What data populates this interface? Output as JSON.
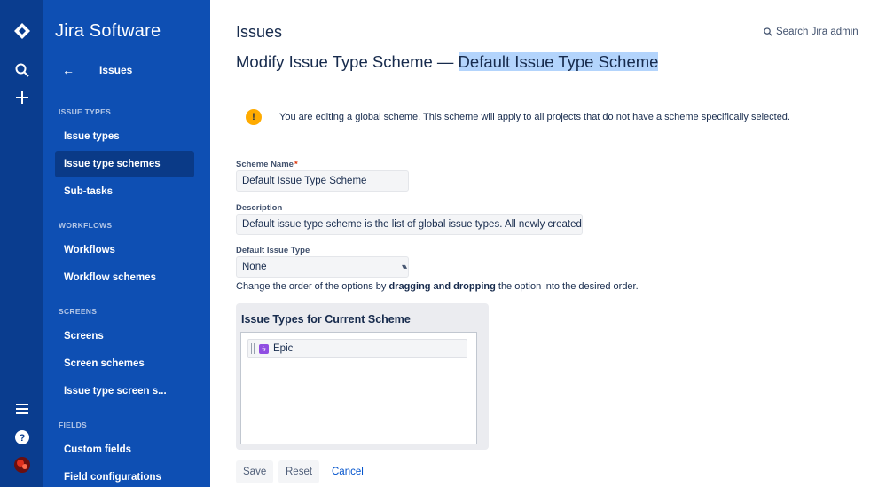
{
  "rail": {
    "icons": [
      "jira-logo-icon",
      "search-icon",
      "create-icon",
      "menu-icon",
      "help-icon",
      "avatar"
    ]
  },
  "sidebar": {
    "brand": "Jira Software",
    "back_label": "Issues",
    "sections": [
      {
        "heading": "ISSUE TYPES",
        "items": [
          {
            "label": "Issue types",
            "active": false
          },
          {
            "label": "Issue type schemes",
            "active": true
          },
          {
            "label": "Sub-tasks",
            "active": false
          }
        ]
      },
      {
        "heading": "WORKFLOWS",
        "items": [
          {
            "label": "Workflows",
            "active": false
          },
          {
            "label": "Workflow schemes",
            "active": false
          }
        ]
      },
      {
        "heading": "SCREENS",
        "items": [
          {
            "label": "Screens",
            "active": false
          },
          {
            "label": "Screen schemes",
            "active": false
          },
          {
            "label": "Issue type screen s...",
            "active": false
          }
        ]
      },
      {
        "heading": "FIELDS",
        "items": [
          {
            "label": "Custom fields",
            "active": false
          },
          {
            "label": "Field configurations",
            "active": false
          }
        ]
      }
    ]
  },
  "header": {
    "section_title": "Issues",
    "search_admin": "Search Jira admin",
    "title_prefix": "Modify Issue Type Scheme — ",
    "title_highlight": "Default Issue Type Scheme"
  },
  "warning": {
    "text": "You are editing a global scheme. This scheme will apply to all projects that do not have a scheme specifically selected."
  },
  "form": {
    "scheme_name_label": "Scheme Name",
    "scheme_name_required": "*",
    "scheme_name_value": "Default Issue Type Scheme",
    "description_label": "Description",
    "description_value": "Default issue type scheme is the list of global issue types. All newly created",
    "default_type_label": "Default Issue Type",
    "default_type_value": "None",
    "hint_before": "Change the order of the options by ",
    "hint_bold": "dragging and dropping",
    "hint_after": " the option into the desired order."
  },
  "panel": {
    "title": "Issue Types for Current Scheme",
    "items": [
      {
        "label": "Epic",
        "icon": "epic-icon"
      }
    ]
  },
  "actions": {
    "save": "Save",
    "reset": "Reset",
    "cancel": "Cancel"
  },
  "colors": {
    "rail": "#0a3d8f",
    "sidebar": "#0e4fb3",
    "sidebar_active": "#0a3a87",
    "link": "#0052cc",
    "warning": "#ffab00",
    "epic": "#904ee2"
  }
}
